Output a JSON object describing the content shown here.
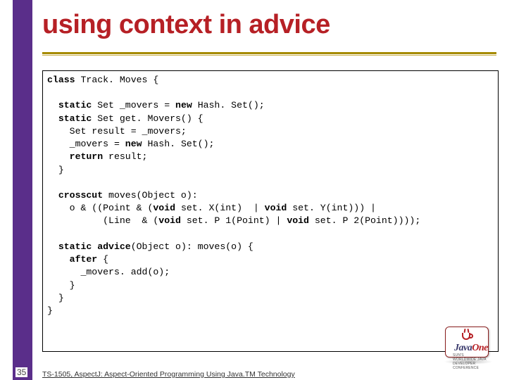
{
  "title": "using context in advice",
  "page_number": "35",
  "footer": "TS-1505, AspectJ: Aspect-Oriented Programming Using Java.TM Technology",
  "logo": {
    "label": "Java",
    "suffix": "One",
    "sub": "SUN'S WORLDWIDE JAVA DEVELOPER CONFERENCE"
  },
  "code": {
    "l01a": "class",
    "l01b": " Track. Moves {",
    "l03a": "  static",
    "l03b": " Set _movers = ",
    "l03c": "new",
    "l03d": " Hash. Set();",
    "l04a": "  static",
    "l04b": " Set get. Movers() {",
    "l05": "    Set result = _movers;",
    "l06a": "    _movers = ",
    "l06b": "new",
    "l06c": " Hash. Set();",
    "l07a": "    return",
    "l07b": " result;",
    "l08": "  }",
    "l10a": "  crosscut",
    "l10b": " moves(Object o):",
    "l11a": "    o & ((Point & (",
    "l11b": "void",
    "l11c": " set. X(int)  | ",
    "l11d": "void",
    "l11e": " set. Y(int))) |",
    "l12a": "          (Line  & (",
    "l12b": "void",
    "l12c": " set. P 1(Point) | ",
    "l12d": "void",
    "l12e": " set. P 2(Point))));",
    "l14a": "  static advice",
    "l14b": "(Object o): moves(o) {",
    "l15a": "    after",
    "l15b": " {",
    "l16": "      _movers. add(o);",
    "l17": "    }",
    "l18": "  }",
    "l19": "}"
  }
}
